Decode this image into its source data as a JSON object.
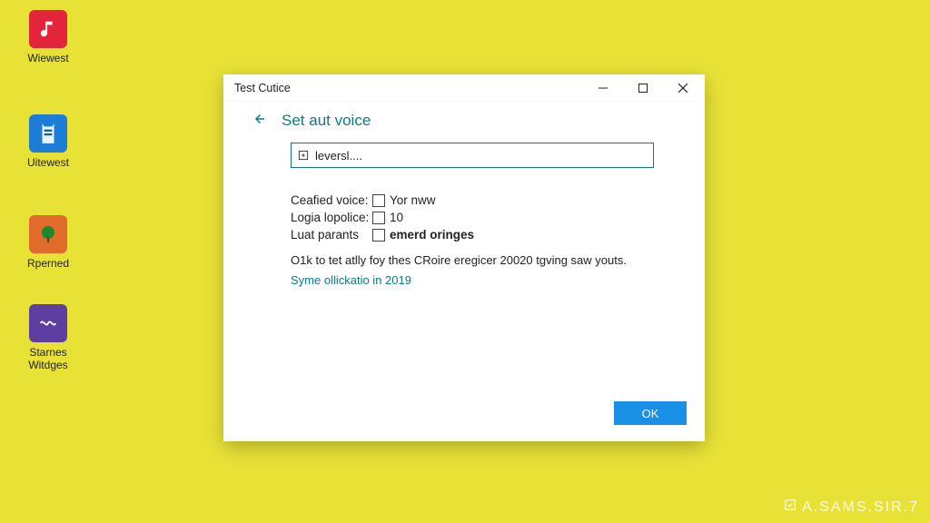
{
  "desktop": {
    "icons": [
      {
        "label": "Wiewest"
      },
      {
        "label": "Uitewest"
      },
      {
        "label": "Rperned"
      },
      {
        "label": "Starnes Witdges"
      }
    ]
  },
  "dialog": {
    "title": "Test Cutice",
    "heading": "Set aut voice",
    "input_value": "leversl....",
    "rows": [
      {
        "label": "Ceafied voice:",
        "value": "Yor nww"
      },
      {
        "label": "Logia lopolice:",
        "value": "10"
      },
      {
        "label": "Luat parants",
        "value": "emerd oringes"
      }
    ],
    "description": "O1k to tet atlly foy thes CRoire eregicer 20020 tgving saw youts.",
    "link": "Syme ollickatio in 2019",
    "ok_label": "OK"
  },
  "watermark": "A.SAMS.SIR.7"
}
